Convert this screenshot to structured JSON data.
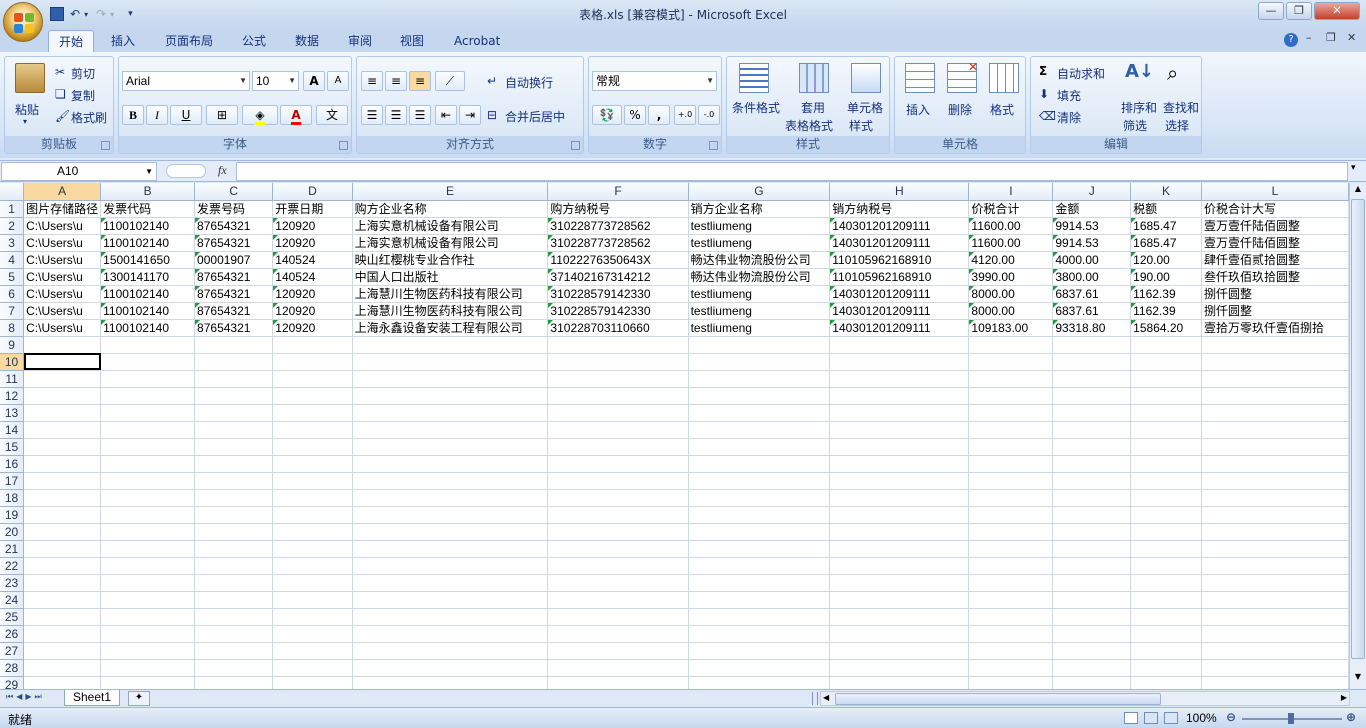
{
  "window": {
    "title": "表格.xls  [兼容模式] - Microsoft Excel"
  },
  "tabs": [
    "开始",
    "插入",
    "页面布局",
    "公式",
    "数据",
    "审阅",
    "视图",
    "Acrobat"
  ],
  "ribbon": {
    "clipboard": {
      "label": "剪贴板",
      "paste": "粘贴",
      "cut": "剪切",
      "copy": "复制",
      "format_painter": "格式刷"
    },
    "font": {
      "label": "字体",
      "name": "Arial",
      "size": "10",
      "bold": "B",
      "italic": "I",
      "underline": "U",
      "grow": "A",
      "shrink": "A",
      "wen": "文"
    },
    "alignment": {
      "label": "对齐方式",
      "wrap": "自动换行",
      "merge": "合并后居中"
    },
    "number": {
      "label": "数字",
      "format": "常规",
      "percent": "%",
      "comma": ",",
      "inc": "+.0",
      "dec": "-.0"
    },
    "styles": {
      "label": "样式",
      "conditional": "条件格式",
      "table1": "套用",
      "table2": "表格格式",
      "cell1": "单元格",
      "cell2": "样式"
    },
    "cells": {
      "label": "单元格",
      "insert": "插入",
      "delete": "删除",
      "format": "格式"
    },
    "editing": {
      "label": "编辑",
      "autosum": "自动求和",
      "fill": "填充",
      "clear": "清除",
      "sort1": "排序和",
      "sort2": "筛选",
      "find1": "查找和",
      "find2": "选择"
    }
  },
  "formula_bar": {
    "name_box": "A10",
    "fx": "fx",
    "value": ""
  },
  "columns": [
    "A",
    "B",
    "C",
    "D",
    "E",
    "F",
    "G",
    "H",
    "I",
    "J",
    "K",
    "L"
  ],
  "rows": [
    [
      "图片存储路径",
      "发票代码",
      "发票号码",
      "开票日期",
      "购方企业名称",
      "购方纳税号",
      "销方企业名称",
      "销方纳税号",
      "价税合计",
      "金额",
      "税额",
      "价税合计大写"
    ],
    [
      "C:\\Users\\u",
      "1100102140",
      "87654321",
      "120920",
      "上海实意机械设备有限公司",
      "310228773728562",
      "testliumeng",
      "140301201209111",
      "11600.00",
      "9914.53",
      "1685.47",
      "壹万壹仟陆佰圆整"
    ],
    [
      "C:\\Users\\u",
      "1100102140",
      "87654321",
      "120920",
      "上海实意机械设备有限公司",
      "310228773728562",
      "testliumeng",
      "140301201209111",
      "11600.00",
      "9914.53",
      "1685.47",
      "壹万壹仟陆佰圆整"
    ],
    [
      "C:\\Users\\u",
      "1500141650",
      "00001907",
      "140524",
      "映山红樱桃专业合作社",
      "11022276350643X",
      "畅达伟业物流股份公司",
      "110105962168910",
      "4120.00",
      "4000.00",
      "120.00",
      "肆仟壹佰贰拾圆整"
    ],
    [
      "C:\\Users\\u",
      "1300141170",
      "87654321",
      "140524",
      "中国人口出版社",
      "371402167314212",
      "畅达伟业物流股份公司",
      "110105962168910",
      "3990.00",
      "3800.00",
      "190.00",
      "叁仟玖佰玖拾圆整"
    ],
    [
      "C:\\Users\\u",
      "1100102140",
      "87654321",
      "120920",
      "上海慧川生物医药科技有限公司",
      "310228579142330",
      "testliumeng",
      "140301201209111",
      "8000.00",
      "6837.61",
      "1162.39",
      "捌仟圆整"
    ],
    [
      "C:\\Users\\u",
      "1100102140",
      "87654321",
      "120920",
      "上海慧川生物医药科技有限公司",
      "310228579142330",
      "testliumeng",
      "140301201209111",
      "8000.00",
      "6837.61",
      "1162.39",
      "捌仟圆整"
    ],
    [
      "C:\\Users\\u",
      "1100102140",
      "87654321",
      "120920",
      "上海永鑫设备安装工程有限公司",
      "310228703110660",
      "testliumeng",
      "140301201209111",
      "109183.00",
      "93318.80",
      "15864.20",
      "壹拾万零玖仟壹佰捌拾"
    ]
  ],
  "total_rows": 29,
  "selected_row": 10,
  "sheet": {
    "name": "Sheet1"
  },
  "status": {
    "ready": "就绪",
    "zoom": "100%"
  }
}
